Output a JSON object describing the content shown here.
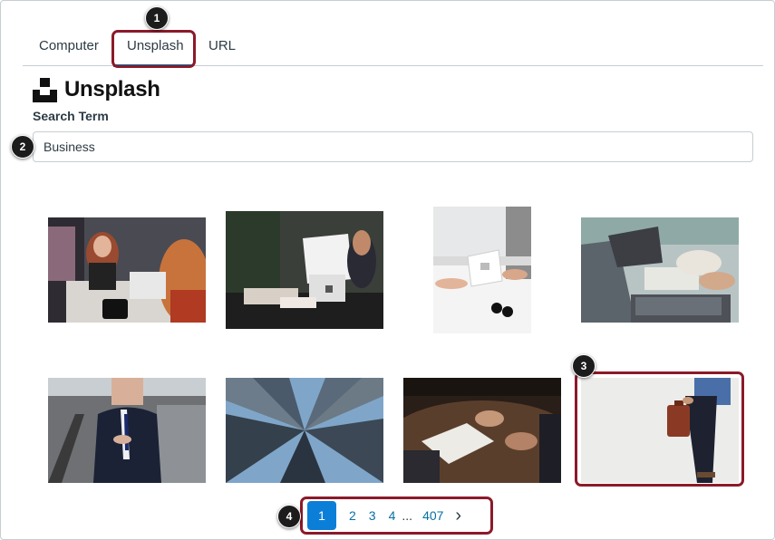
{
  "tabs": [
    {
      "label": "Computer"
    },
    {
      "label": "Unsplash",
      "selected": true
    },
    {
      "label": "URL"
    }
  ],
  "logo": {
    "text": "Unsplash"
  },
  "search": {
    "label": "Search Term",
    "value": "Business"
  },
  "images": [
    {
      "icon": "photo-retail-checkout"
    },
    {
      "icon": "photo-card-terminal"
    },
    {
      "icon": "photo-payment-reader"
    },
    {
      "icon": "photo-laptop-meeting"
    },
    {
      "icon": "photo-businessman-suit"
    },
    {
      "icon": "photo-skyscrapers"
    },
    {
      "icon": "photo-desk-discussion"
    },
    {
      "icon": "photo-briefcase-walk"
    }
  ],
  "pagination": {
    "current": "1",
    "pages": [
      "2",
      "3",
      "4"
    ],
    "ellipsis": "...",
    "last": "407",
    "next_icon": "chevron-right-icon"
  },
  "callouts": [
    "1",
    "2",
    "3",
    "4"
  ],
  "colors": {
    "accent": "#0770a3",
    "highlight": "#8b1a2a",
    "current_page": "#0b7fd8"
  }
}
